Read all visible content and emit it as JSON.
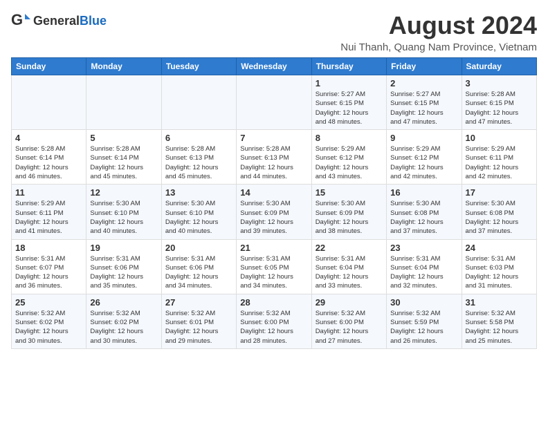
{
  "header": {
    "logo_general": "General",
    "logo_blue": "Blue",
    "month_title": "August 2024",
    "location": "Nui Thanh, Quang Nam Province, Vietnam"
  },
  "weekdays": [
    "Sunday",
    "Monday",
    "Tuesday",
    "Wednesday",
    "Thursday",
    "Friday",
    "Saturday"
  ],
  "weeks": [
    [
      {
        "day": "",
        "detail": ""
      },
      {
        "day": "",
        "detail": ""
      },
      {
        "day": "",
        "detail": ""
      },
      {
        "day": "",
        "detail": ""
      },
      {
        "day": "1",
        "detail": "Sunrise: 5:27 AM\nSunset: 6:15 PM\nDaylight: 12 hours\nand 48 minutes."
      },
      {
        "day": "2",
        "detail": "Sunrise: 5:27 AM\nSunset: 6:15 PM\nDaylight: 12 hours\nand 47 minutes."
      },
      {
        "day": "3",
        "detail": "Sunrise: 5:28 AM\nSunset: 6:15 PM\nDaylight: 12 hours\nand 47 minutes."
      }
    ],
    [
      {
        "day": "4",
        "detail": "Sunrise: 5:28 AM\nSunset: 6:14 PM\nDaylight: 12 hours\nand 46 minutes."
      },
      {
        "day": "5",
        "detail": "Sunrise: 5:28 AM\nSunset: 6:14 PM\nDaylight: 12 hours\nand 45 minutes."
      },
      {
        "day": "6",
        "detail": "Sunrise: 5:28 AM\nSunset: 6:13 PM\nDaylight: 12 hours\nand 45 minutes."
      },
      {
        "day": "7",
        "detail": "Sunrise: 5:28 AM\nSunset: 6:13 PM\nDaylight: 12 hours\nand 44 minutes."
      },
      {
        "day": "8",
        "detail": "Sunrise: 5:29 AM\nSunset: 6:12 PM\nDaylight: 12 hours\nand 43 minutes."
      },
      {
        "day": "9",
        "detail": "Sunrise: 5:29 AM\nSunset: 6:12 PM\nDaylight: 12 hours\nand 42 minutes."
      },
      {
        "day": "10",
        "detail": "Sunrise: 5:29 AM\nSunset: 6:11 PM\nDaylight: 12 hours\nand 42 minutes."
      }
    ],
    [
      {
        "day": "11",
        "detail": "Sunrise: 5:29 AM\nSunset: 6:11 PM\nDaylight: 12 hours\nand 41 minutes."
      },
      {
        "day": "12",
        "detail": "Sunrise: 5:30 AM\nSunset: 6:10 PM\nDaylight: 12 hours\nand 40 minutes."
      },
      {
        "day": "13",
        "detail": "Sunrise: 5:30 AM\nSunset: 6:10 PM\nDaylight: 12 hours\nand 40 minutes."
      },
      {
        "day": "14",
        "detail": "Sunrise: 5:30 AM\nSunset: 6:09 PM\nDaylight: 12 hours\nand 39 minutes."
      },
      {
        "day": "15",
        "detail": "Sunrise: 5:30 AM\nSunset: 6:09 PM\nDaylight: 12 hours\nand 38 minutes."
      },
      {
        "day": "16",
        "detail": "Sunrise: 5:30 AM\nSunset: 6:08 PM\nDaylight: 12 hours\nand 37 minutes."
      },
      {
        "day": "17",
        "detail": "Sunrise: 5:30 AM\nSunset: 6:08 PM\nDaylight: 12 hours\nand 37 minutes."
      }
    ],
    [
      {
        "day": "18",
        "detail": "Sunrise: 5:31 AM\nSunset: 6:07 PM\nDaylight: 12 hours\nand 36 minutes."
      },
      {
        "day": "19",
        "detail": "Sunrise: 5:31 AM\nSunset: 6:06 PM\nDaylight: 12 hours\nand 35 minutes."
      },
      {
        "day": "20",
        "detail": "Sunrise: 5:31 AM\nSunset: 6:06 PM\nDaylight: 12 hours\nand 34 minutes."
      },
      {
        "day": "21",
        "detail": "Sunrise: 5:31 AM\nSunset: 6:05 PM\nDaylight: 12 hours\nand 34 minutes."
      },
      {
        "day": "22",
        "detail": "Sunrise: 5:31 AM\nSunset: 6:04 PM\nDaylight: 12 hours\nand 33 minutes."
      },
      {
        "day": "23",
        "detail": "Sunrise: 5:31 AM\nSunset: 6:04 PM\nDaylight: 12 hours\nand 32 minutes."
      },
      {
        "day": "24",
        "detail": "Sunrise: 5:31 AM\nSunset: 6:03 PM\nDaylight: 12 hours\nand 31 minutes."
      }
    ],
    [
      {
        "day": "25",
        "detail": "Sunrise: 5:32 AM\nSunset: 6:02 PM\nDaylight: 12 hours\nand 30 minutes."
      },
      {
        "day": "26",
        "detail": "Sunrise: 5:32 AM\nSunset: 6:02 PM\nDaylight: 12 hours\nand 30 minutes."
      },
      {
        "day": "27",
        "detail": "Sunrise: 5:32 AM\nSunset: 6:01 PM\nDaylight: 12 hours\nand 29 minutes."
      },
      {
        "day": "28",
        "detail": "Sunrise: 5:32 AM\nSunset: 6:00 PM\nDaylight: 12 hours\nand 28 minutes."
      },
      {
        "day": "29",
        "detail": "Sunrise: 5:32 AM\nSunset: 6:00 PM\nDaylight: 12 hours\nand 27 minutes."
      },
      {
        "day": "30",
        "detail": "Sunrise: 5:32 AM\nSunset: 5:59 PM\nDaylight: 12 hours\nand 26 minutes."
      },
      {
        "day": "31",
        "detail": "Sunrise: 5:32 AM\nSunset: 5:58 PM\nDaylight: 12 hours\nand 25 minutes."
      }
    ]
  ]
}
